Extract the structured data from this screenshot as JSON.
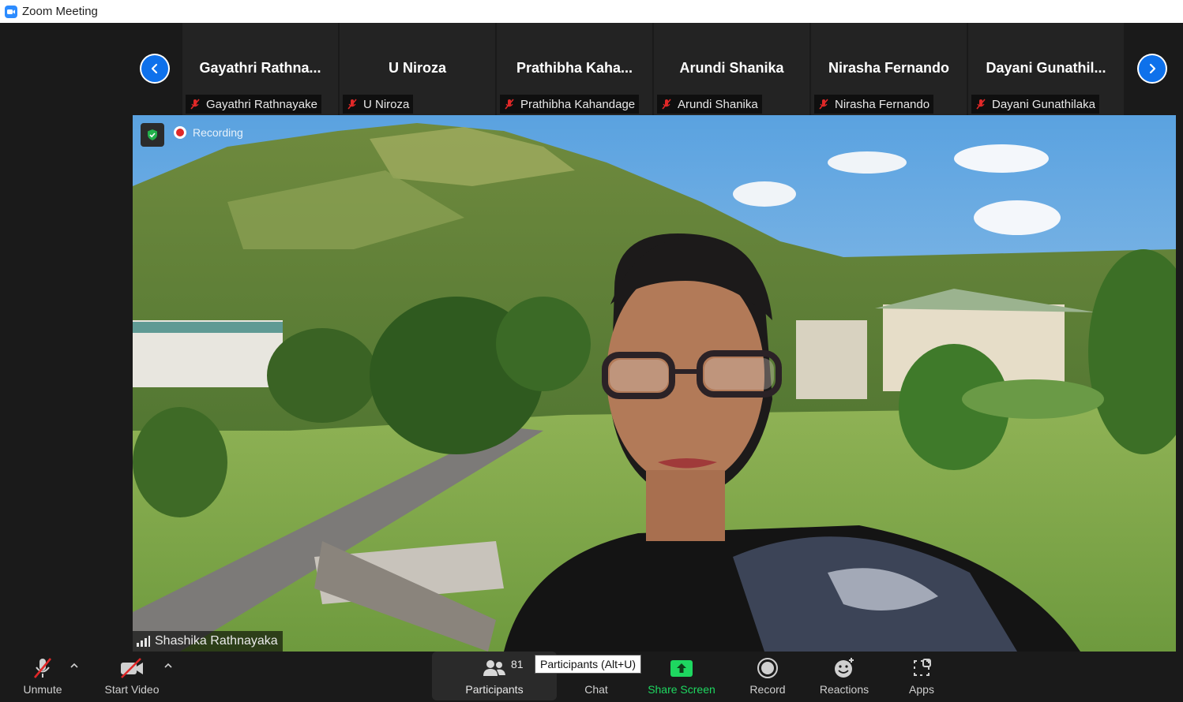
{
  "window": {
    "title": "Zoom Meeting"
  },
  "gallery": {
    "tiles": [
      {
        "display_name": "Gayathri  Rathna...",
        "tag": "Gayathri Rathnayake"
      },
      {
        "display_name": "U Niroza",
        "tag": "U Niroza"
      },
      {
        "display_name": "Prathibha  Kaha...",
        "tag": "Prathibha Kahandage"
      },
      {
        "display_name": "Arundi Shanika",
        "tag": "Arundi Shanika"
      },
      {
        "display_name": "Nirasha Fernando",
        "tag": "Nirasha Fernando"
      },
      {
        "display_name": "Dayani  Gunathil...",
        "tag": "Dayani Gunathilaka"
      }
    ]
  },
  "main_video": {
    "recording_label": "Recording",
    "speaker_name": "Shashika Rathnayaka"
  },
  "toolbar": {
    "unmute": "Unmute",
    "start_video": "Start Video",
    "participants": "Participants",
    "participant_count": "81",
    "participants_tooltip": "Participants (Alt+U)",
    "chat": "Chat",
    "share_screen": "Share Screen",
    "record": "Record",
    "reactions": "Reactions",
    "apps": "Apps"
  },
  "colors": {
    "accent_blue": "#0e71eb",
    "share_green": "#1ed760",
    "mute_red": "#e02828",
    "background": "#1a1a1a"
  }
}
